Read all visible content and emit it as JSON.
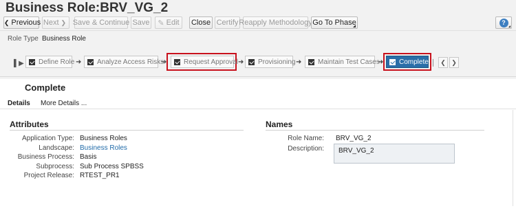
{
  "header": {
    "title": "Business Role:BRV_VG_2"
  },
  "toolbar": {
    "previous": "Previous",
    "next": "Next",
    "save_continue": "Save & Continue",
    "save": "Save",
    "edit": "Edit",
    "close": "Close",
    "certify": "Certify",
    "reapply": "Reapply Methodology",
    "go_to_phase": "Go To Phase",
    "help_glyph": "?"
  },
  "role_type": {
    "label": "Role Type",
    "value": "Business Role"
  },
  "phases": [
    {
      "label": "Define Role",
      "checked": true,
      "active": false,
      "highlighted": false
    },
    {
      "label": "Analyze Access Risks",
      "checked": true,
      "active": false,
      "highlighted": false
    },
    {
      "label": "Request Approval",
      "checked": true,
      "active": false,
      "highlighted": true
    },
    {
      "label": "Provisioning",
      "checked": true,
      "active": false,
      "highlighted": false
    },
    {
      "label": "Maintain Test Cases",
      "checked": true,
      "active": false,
      "highlighted": false
    },
    {
      "label": "Complete",
      "checked": true,
      "active": true,
      "highlighted": true
    }
  ],
  "colors": {
    "active_phase": "#2a6ea8",
    "highlight_border": "#c8101c",
    "link": "#1f6aa8"
  },
  "section": {
    "title": "Complete"
  },
  "tabs": {
    "details": "Details",
    "more_details": "More Details ..."
  },
  "attributes": {
    "title": "Attributes",
    "application_type_label": "Application Type:",
    "application_type_value": "Business Roles",
    "landscape_label": "Landscape:",
    "landscape_value": "Business Roles",
    "business_process_label": "Business Process:",
    "business_process_value": "Basis",
    "subprocess_label": "Subprocess:",
    "subprocess_value": "Sub Process SPBSS",
    "project_release_label": "Project Release:",
    "project_release_value": "RTEST_PR1"
  },
  "names": {
    "title": "Names",
    "role_name_label": "Role Name:",
    "role_name_value": "BRV_VG_2",
    "description_label": "Description:",
    "description_value": "BRV_VG_2"
  }
}
